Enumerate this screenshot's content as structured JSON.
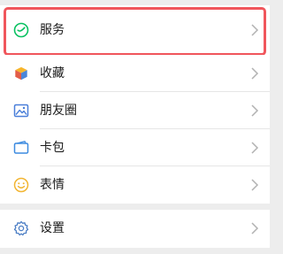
{
  "menu": {
    "services": {
      "label": "服务",
      "icon": "services-check-icon"
    },
    "favorites": {
      "label": "收藏",
      "icon": "favorites-cube-icon"
    },
    "moments": {
      "label": "朋友圈",
      "icon": "moments-picture-icon"
    },
    "cards": {
      "label": "卡包",
      "icon": "wallet-card-icon"
    },
    "stickers": {
      "label": "表情",
      "icon": "smiley-face-icon"
    },
    "settings": {
      "label": "设置",
      "icon": "gear-icon"
    }
  },
  "colors": {
    "highlight": "#f0565c",
    "services_icon": "#07c160",
    "favorites_icon_a": "#f7b52b",
    "favorites_icon_b": "#e35d48",
    "moments_icon": "#4a7fd9",
    "cards_icon": "#3d8be0",
    "stickers_icon": "#f2b531",
    "settings_icon": "#4c7ec5",
    "chevron": "#b2b2b2"
  }
}
